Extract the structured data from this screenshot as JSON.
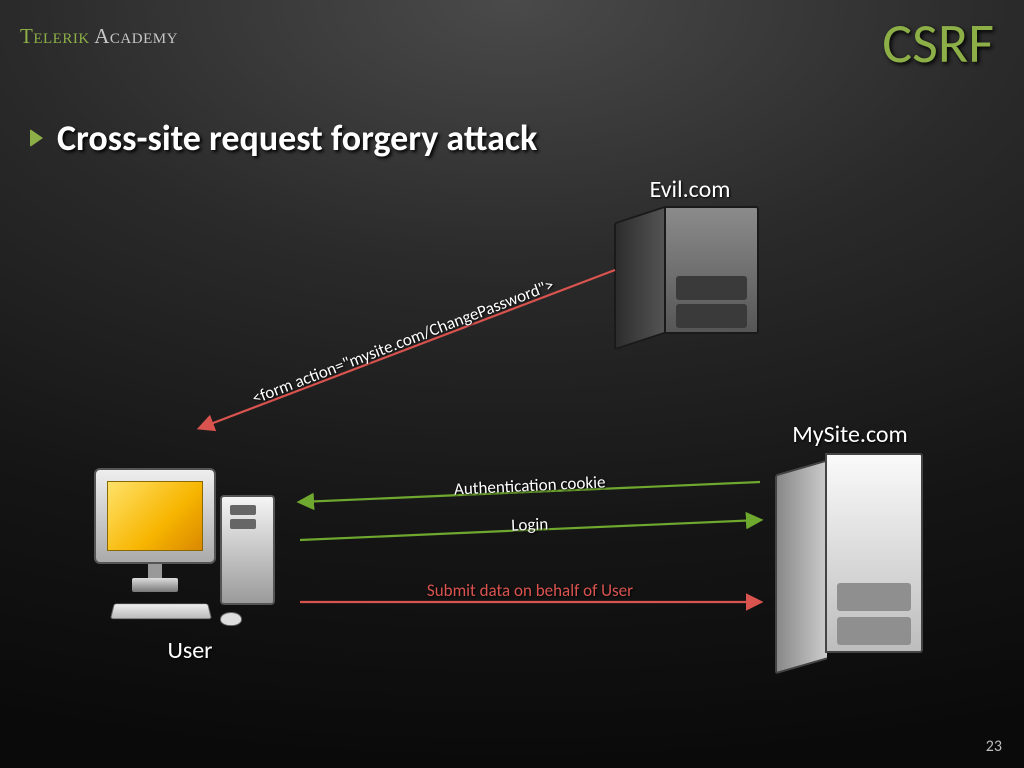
{
  "logo": {
    "part1": "Telerik ",
    "part2": "Academy"
  },
  "title": "CSRF",
  "subtitle": "Cross-site request forgery attack",
  "nodes": {
    "evil": {
      "label": "Evil.com"
    },
    "mysite": {
      "label": "MySite.com"
    },
    "user": {
      "label": "User"
    }
  },
  "arrows": {
    "form_action": "<form action=\"mysite.com/ChangePassword\">",
    "auth_cookie": "Authentication cookie",
    "login": "Login",
    "submit": "Submit data on behalf of User"
  },
  "page_number": "23",
  "colors": {
    "accent": "#8daf47",
    "red": "#d9534f",
    "green_line": "#6fa82f"
  }
}
